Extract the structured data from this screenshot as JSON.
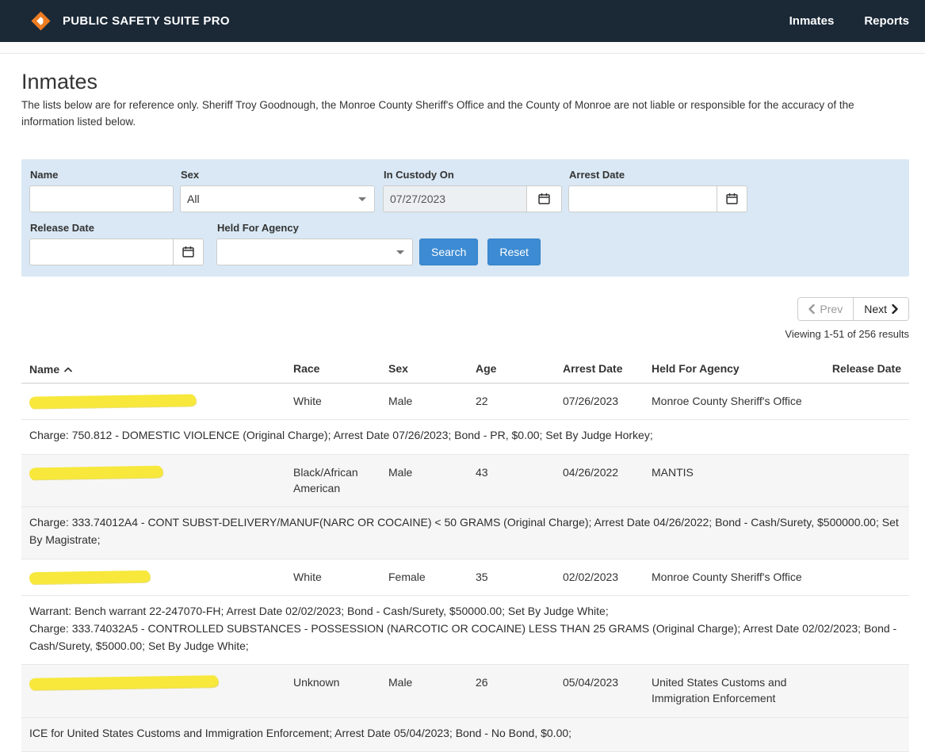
{
  "navbar": {
    "brand": "PUBLIC SAFETY SUITE PRO",
    "links": [
      {
        "label": "Inmates"
      },
      {
        "label": "Reports"
      }
    ],
    "colors": {
      "background": "#1b2937",
      "logo_orange": "#ee7c22"
    }
  },
  "page": {
    "title": "Inmates",
    "disclaimer": "The lists below are for reference only.  Sheriff Troy Goodnough, the Monroe County Sheriff's Office and the County of Monroe are not liable or responsible for the accuracy of the information listed below."
  },
  "filters": {
    "name_label": "Name",
    "name_value": "",
    "sex_label": "Sex",
    "sex_value": "All",
    "in_custody_label": "In Custody On",
    "in_custody_value": "07/27/2023",
    "arrest_date_label": "Arrest Date",
    "arrest_date_value": "",
    "release_date_label": "Release Date",
    "release_date_value": "",
    "held_for_agency_label": "Held For Agency",
    "held_for_agency_value": "",
    "search_label": "Search",
    "reset_label": "Reset",
    "panel_color": "#d9e8f4",
    "button_color": "#3d8bd3",
    "calendar_icon": "calendar-icon"
  },
  "pagination": {
    "prev_label": "Prev",
    "next_label": "Next",
    "status": "Viewing 1-51 of 256 results"
  },
  "table": {
    "headers": [
      "Name",
      "Race",
      "Sex",
      "Age",
      "Arrest Date",
      "Held For Agency",
      "Release Date"
    ],
    "sorted_by": "Name",
    "sort_direction": "asc",
    "redaction_color": "#f7e83b",
    "rows": [
      {
        "name_redacted": true,
        "race": "White",
        "sex": "Male",
        "age": "22",
        "arrest_date": "07/26/2023",
        "held_for_agency": "Monroe County Sheriff's Office",
        "release_date": "",
        "details": [
          "Charge: 750.812 - DOMESTIC VIOLENCE (Original Charge); Arrest Date 07/26/2023; Bond - PR, $0.00; Set By Judge Horkey;"
        ]
      },
      {
        "name_redacted": true,
        "race": "Black/African American",
        "sex": "Male",
        "age": "43",
        "arrest_date": "04/26/2022",
        "held_for_agency": "MANTIS",
        "release_date": "",
        "details": [
          "Charge: 333.74012A4 - CONT SUBST-DELIVERY/MANUF(NARC OR COCAINE) < 50 GRAMS (Original Charge); Arrest Date 04/26/2022; Bond - Cash/Surety, $500000.00; Set By Magistrate;"
        ]
      },
      {
        "name_redacted": true,
        "race": "White",
        "sex": "Female",
        "age": "35",
        "arrest_date": "02/02/2023",
        "held_for_agency": "Monroe County Sheriff's Office",
        "release_date": "",
        "details": [
          "Warrant: Bench warrant 22-247070-FH; Arrest Date 02/02/2023; Bond - Cash/Surety, $50000.00; Set By Judge White;",
          "Charge: 333.74032A5 - CONTROLLED SUBSTANCES - POSSESSION (NARCOTIC OR COCAINE) LESS THAN 25 GRAMS (Original Charge); Arrest Date 02/02/2023; Bond - Cash/Surety, $5000.00; Set By Judge White;"
        ]
      },
      {
        "name_redacted": true,
        "race": "Unknown",
        "sex": "Male",
        "age": "26",
        "arrest_date": "05/04/2023",
        "held_for_agency": "United States Customs and Immigration Enforcement",
        "release_date": "",
        "details": [
          "ICE for United States Customs and Immigration Enforcement; Arrest Date 05/04/2023; Bond - No Bond, $0.00;"
        ]
      }
    ]
  }
}
